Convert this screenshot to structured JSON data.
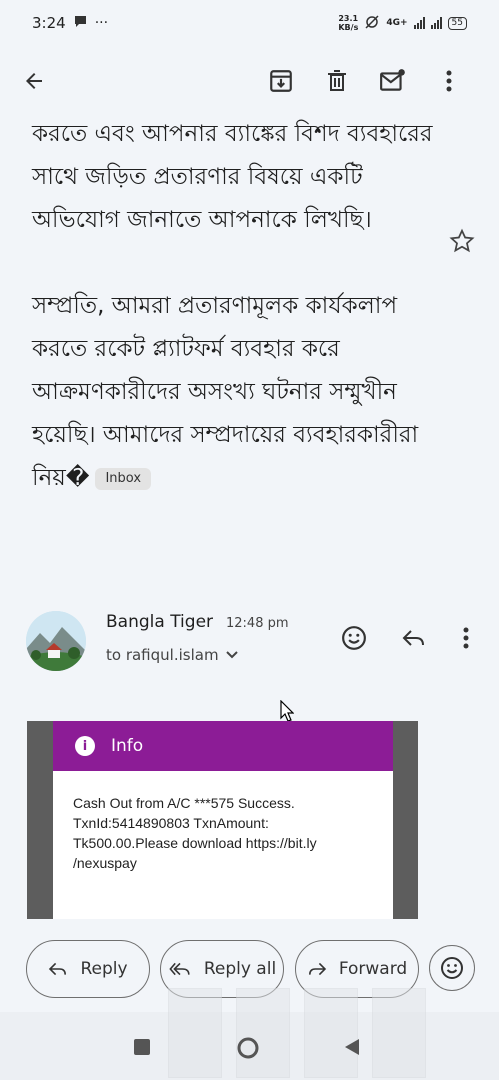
{
  "status": {
    "time": "3:24",
    "speed_top": "23.1",
    "speed_bottom": "KB/s",
    "network": "4G+",
    "battery": "55"
  },
  "email": {
    "body_paragraphs": [
      "করতে এবং আপনার ব্যাঙ্কের বিশদ ব্যবহারের সাথে জড়িত প্রতারণার বিষয়ে একটি অভিযোগ জানাতে আপনাকে লিখছি।",
      "সম্প্রতি, আমরা প্রতারণামূলক কার্যকলাপ করতে রকেট প্ল্যাটফর্ম ব্যবহার করে আক্রমণকারীদের অসংখ্য ঘটনার সম্মুখীন হয়েছি। আমাদের সম্প্রদায়ের ব্যবহারকারীরা নিয়�"
    ],
    "label": "Inbox",
    "sender_name": "Bangla Tiger",
    "time": "12:48 pm",
    "to_line": "to rafiqul.islam"
  },
  "attachment": {
    "header": "Info",
    "message": "Cash Out from A/C ***575 Success. TxnId:5414890803 TxnAmount: Tk500.00.Please download https://bit.ly /nexuspay"
  },
  "actions": {
    "reply": "Reply",
    "reply_all": "Reply all",
    "forward": "Forward"
  },
  "colors": {
    "background": "#f2f5f9",
    "info_header": "#8c1c96",
    "text": "#1f1f1f"
  },
  "icons": [
    "back-arrow-icon",
    "archive-icon",
    "delete-icon",
    "mark-unread-icon",
    "more-vert-icon",
    "star-icon",
    "emoji-icon",
    "reply-icon",
    "reply-all-icon",
    "forward-icon",
    "chevron-down-icon"
  ]
}
